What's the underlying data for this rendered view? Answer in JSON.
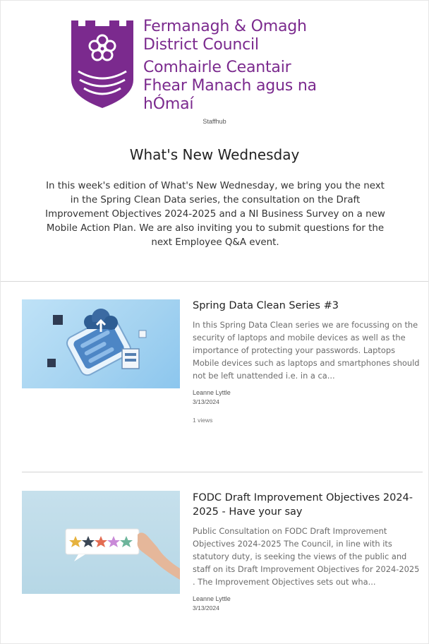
{
  "colors": {
    "brand_purple": "#7b2a8e",
    "divider": "#d3d3d3"
  },
  "header": {
    "org_name_en_line1": "Fermanagh & Omagh",
    "org_name_en_line2": "District Council",
    "org_name_ga_line1": "Comhairle Ceantair",
    "org_name_ga_line2": "Fhear Manach agus na hÓmaí",
    "crest_icon": "council-crest-icon",
    "site_name": "Staffhub",
    "page_title": "What's New Wednesday",
    "intro": "In this week's edition of What's New Wednesday, we bring you the next in the Spring Clean Data series, the consultation on the Draft Improvement Objectives 2024-2025 and a NI Business Survey on a new Mobile Action Plan.  We are also inviting you to submit questions for the next Employee Q&A event."
  },
  "news": [
    {
      "title": "Spring Data Clean Series #3",
      "description": "In this Spring Data Clean series we are focussing on the security of laptops and mobile devices as well as the importance of protecting your passwords. Laptops Mobile devices such as laptops and smartphones should not be left unattended i.e. in a ca...",
      "author": "Leanne Lyttle",
      "date": "3/13/2024",
      "views": "1 views",
      "image_icon": "cloud-smartphone-illustration"
    },
    {
      "title": "FODC Draft Improvement Objectives 2024-2025 - Have your say",
      "description": "Public Consultation on FODC Draft Improvement Objectives 2024-2025 The Council, in line with its statutory duty, is seeking the views of the public and staff on its Draft Improvement Objectives for 2024-2025 . The Improvement Objectives sets out wha...",
      "author": "Leanne Lyttle",
      "date": "3/13/2024",
      "image_icon": "star-rating-illustration"
    }
  ]
}
